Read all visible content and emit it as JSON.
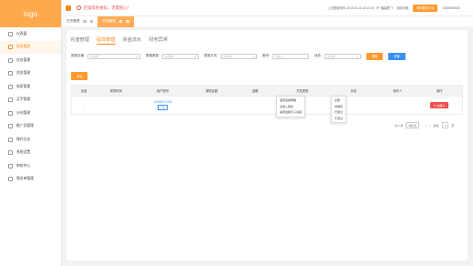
{
  "logo": "logo",
  "sidebar": {
    "items": [
      {
        "label": "仪表盘",
        "active": false
      },
      {
        "label": "财务管理",
        "active": true
      },
      {
        "label": "任务管理",
        "active": false
      },
      {
        "label": "资金管理",
        "active": false
      },
      {
        "label": "商家管理",
        "active": false
      },
      {
        "label": "买手管理",
        "active": false
      },
      {
        "label": "分站管理",
        "active": false
      },
      {
        "label": "推广员管理",
        "active": false
      },
      {
        "label": "操作日志",
        "active": false
      },
      {
        "label": "系统设置",
        "active": false
      },
      {
        "label": "审核中心",
        "active": false
      },
      {
        "label": "黑名单管理",
        "active": false
      }
    ]
  },
  "topbar": {
    "notice": "店铺资金被扣，无需担心！",
    "login_info": "上次登录时间: 2019-10-11 14:10:19，IP: 福建厦门",
    "switch_label": "版本切换",
    "highlight_button": "修改联系方式",
    "phone": "13800000000"
  },
  "tabs": [
    {
      "label": "任务管理",
      "active": false
    },
    {
      "label": "财务管理",
      "active": true
    }
  ],
  "subtabs": [
    {
      "label": "充值管理",
      "active": false
    },
    {
      "label": "提现管理",
      "active": true
    },
    {
      "label": "资金流水",
      "active": false
    },
    {
      "label": "财务异常",
      "active": false
    }
  ],
  "filters": {
    "date_label": "提现日期:",
    "date_placeholder": "请选择",
    "category_label": "提现类型:",
    "category_placeholder": "请选择",
    "method_label": "提现方式:",
    "method_placeholder": "请选择",
    "account_label": "账号:",
    "account_placeholder": "请输入",
    "status_label": "状态:",
    "status_placeholder": "请选择",
    "search_button": "搜索",
    "reset_button": "重置"
  },
  "export_button": "导出",
  "table": {
    "headers": [
      "全选",
      "提现时间",
      "用户账号",
      "提现金额",
      "金额",
      "开发类型",
      "状态",
      "操作人",
      "操作"
    ],
    "rows": [
      {
        "select": "",
        "time": "",
        "account": "13456721333",
        "account_tag": "已付",
        "amount": "",
        "money": "",
        "type": "",
        "status": "",
        "operator": "",
        "action": "去确认"
      }
    ]
  },
  "type_dropdown": {
    "options": [
      "提现金额明细",
      "余额入账表",
      "提现金额与子余额"
    ]
  },
  "status_dropdown": {
    "options": [
      "全部",
      "待审核",
      "已通过",
      "不通过"
    ]
  },
  "pager": {
    "total": "共 1 条",
    "page_size": "5条/页",
    "current": "1",
    "goto_label": "前往",
    "goto_value": "1",
    "page_suffix": "页"
  }
}
